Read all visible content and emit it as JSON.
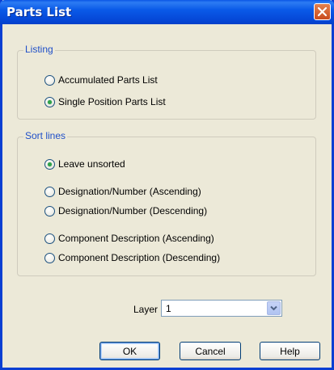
{
  "window": {
    "title": "Parts List"
  },
  "listing": {
    "legend": "Listing",
    "options": [
      {
        "label": "Accumulated Parts List",
        "checked": false
      },
      {
        "label": "Single Position Parts List",
        "checked": true
      }
    ]
  },
  "sort": {
    "legend": "Sort lines",
    "options": [
      {
        "label": "Leave unsorted",
        "checked": true
      },
      {
        "label": "Designation/Number (Ascending)",
        "checked": false
      },
      {
        "label": "Designation/Number (Descending)",
        "checked": false
      },
      {
        "label": "Component Description (Ascending)",
        "checked": false
      },
      {
        "label": "Component Description (Descending)",
        "checked": false
      }
    ]
  },
  "layer": {
    "label": "Layer",
    "value": "1"
  },
  "buttons": {
    "ok": "OK",
    "cancel": "Cancel",
    "help": "Help"
  },
  "colors": {
    "title_bar": "#0a55e6",
    "legend_text": "#1f4fc8",
    "dialog_bg": "#ece9d8",
    "radio_dot": "#2fa34a"
  },
  "icons": {
    "close": "close-icon",
    "dropdown": "chevron-down-icon"
  }
}
